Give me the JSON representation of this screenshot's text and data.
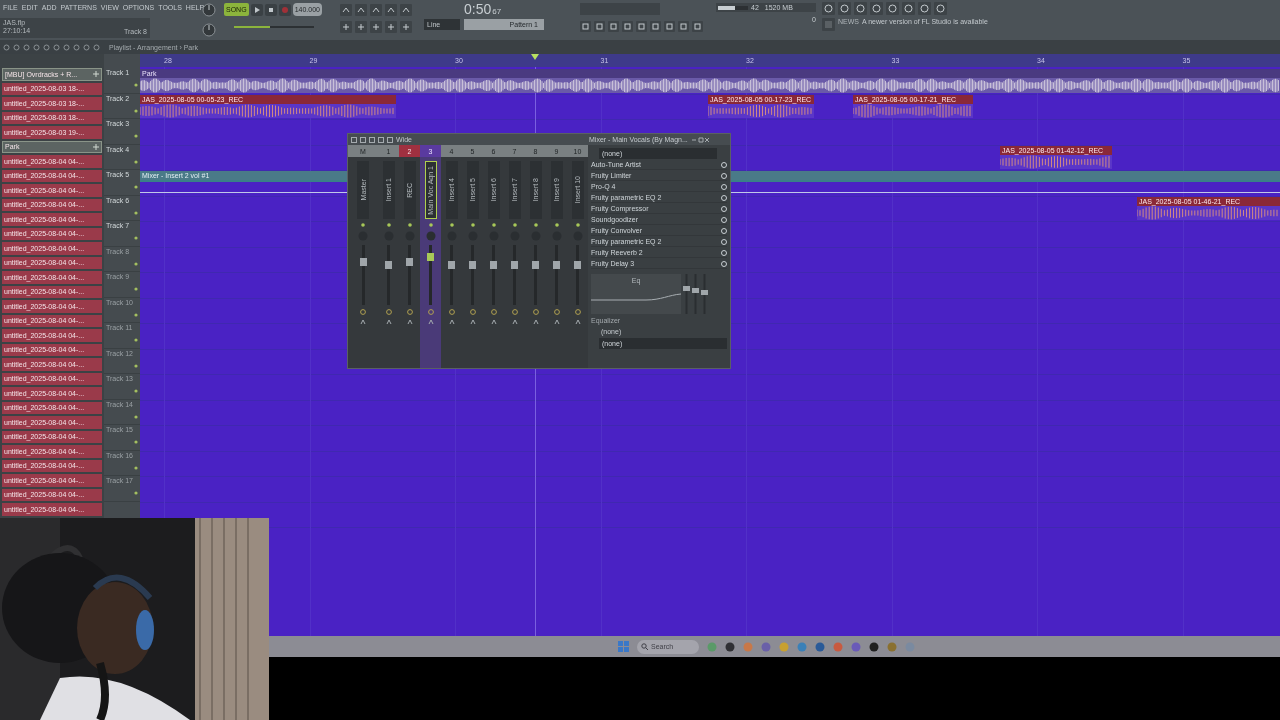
{
  "menu": [
    "FILE",
    "EDIT",
    "ADD",
    "PATTERNS",
    "VIEW",
    "OPTIONS",
    "TOOLS",
    "HELP"
  ],
  "project": {
    "file": "JAS.flp",
    "time": "27:10:14",
    "track": "Track 8"
  },
  "transport": {
    "mode": "SONG",
    "tempo": "140.000",
    "song_time": "0:50",
    "song_time_small": "67",
    "playing": false,
    "recording": false
  },
  "monitor": {
    "voices": "42",
    "memory": "1520 MB",
    "cpu": "0",
    "level": 0.55
  },
  "snap": "Line",
  "pattern": "Pattern 1",
  "news": {
    "label": "NEWS",
    "text": "A newer version of FL Studio is available"
  },
  "master_pitch": {
    "level": 0.45
  },
  "playlist": {
    "title": "Playlist - Arrangement › Park",
    "ruler": [
      "28",
      "29",
      "30",
      "31",
      "32",
      "33",
      "34",
      "35"
    ],
    "picker": [
      {
        "kind": "pattern",
        "label": "[MBU] Ovrdracks + R..."
      },
      {
        "kind": "audio",
        "label": "untitled_2025-08-03 18-..."
      },
      {
        "kind": "audio",
        "label": "untitled_2025-08-03 18-..."
      },
      {
        "kind": "audio",
        "label": "untitled_2025-08-03 18-..."
      },
      {
        "kind": "audio",
        "label": "untitled_2025-08-03 19-..."
      },
      {
        "kind": "pattern",
        "label": "Park"
      },
      {
        "kind": "audio",
        "label": "untitled_2025-08-04 04-..."
      },
      {
        "kind": "audio",
        "label": "untitled_2025-08-04 04-..."
      },
      {
        "kind": "audio",
        "label": "untitled_2025-08-04 04-..."
      },
      {
        "kind": "audio",
        "label": "untitled_2025-08-04 04-..."
      },
      {
        "kind": "audio",
        "label": "untitled_2025-08-04 04-..."
      },
      {
        "kind": "audio",
        "label": "untitled_2025-08-04 04-..."
      },
      {
        "kind": "audio",
        "label": "untitled_2025-08-04 04-..."
      },
      {
        "kind": "audio",
        "label": "untitled_2025-08-04 04-..."
      },
      {
        "kind": "audio",
        "label": "untitled_2025-08-04 04-..."
      },
      {
        "kind": "audio",
        "label": "untitled_2025-08-04 04-..."
      },
      {
        "kind": "audio",
        "label": "untitled_2025-08-04 04-..."
      },
      {
        "kind": "audio",
        "label": "untitled_2025-08-04 04-..."
      },
      {
        "kind": "audio",
        "label": "untitled_2025-08-04 04-..."
      },
      {
        "kind": "audio",
        "label": "untitled_2025-08-04 04-..."
      },
      {
        "kind": "audio",
        "label": "untitled_2025-08-04 04-..."
      },
      {
        "kind": "audio",
        "label": "untitled_2025-08-04 04-..."
      },
      {
        "kind": "audio",
        "label": "untitled_2025-08-04 04-..."
      },
      {
        "kind": "audio",
        "label": "untitled_2025-08-04 04-..."
      },
      {
        "kind": "audio",
        "label": "untitled_2025-08-04 04-..."
      },
      {
        "kind": "audio",
        "label": "untitled_2025-08-04 04-..."
      },
      {
        "kind": "audio",
        "label": "untitled_2025-08-04 04-..."
      },
      {
        "kind": "audio",
        "label": "untitled_2025-08-04 04-..."
      },
      {
        "kind": "audio",
        "label": "untitled_2025-08-04 04-..."
      },
      {
        "kind": "audio",
        "label": "untitled_2025-08-04 04-..."
      },
      {
        "kind": "audio",
        "label": "untitled_2025-08-04 04-..."
      }
    ],
    "tracks": [
      {
        "name": "Track 1",
        "used": true
      },
      {
        "name": "Track 2",
        "used": true
      },
      {
        "name": "Track 3",
        "used": true
      },
      {
        "name": "Track 4",
        "used": true
      },
      {
        "name": "Track 5",
        "used": true
      },
      {
        "name": "Track 6",
        "used": true
      },
      {
        "name": "Track 7",
        "used": true
      },
      {
        "name": "Track 8",
        "used": false
      },
      {
        "name": "Track 9",
        "used": false
      },
      {
        "name": "Track 10",
        "used": false
      },
      {
        "name": "Track 11",
        "used": false
      },
      {
        "name": "Track 12",
        "used": false
      },
      {
        "name": "Track 13",
        "used": false
      },
      {
        "name": "Track 14",
        "used": false
      },
      {
        "name": "Track 15",
        "used": false
      },
      {
        "name": "Track 16",
        "used": false
      },
      {
        "name": "Track 17",
        "used": false
      }
    ],
    "clips": [
      {
        "kind": "audio",
        "label": "Park"
      },
      {
        "kind": "audio",
        "label": "JAS_2025-08-05 00-05-23_REC"
      },
      {
        "kind": "audio",
        "label": "JAS_2025-08-05 00-17-23_REC"
      },
      {
        "kind": "audio",
        "label": "JAS_2025-08-05 00-17-21_REC"
      },
      {
        "kind": "audio",
        "label": "JAS_2025-08-05 01-42-12_REC"
      },
      {
        "kind": "automation",
        "label": "Mixer - Insert 2 vol #1"
      },
      {
        "kind": "audio",
        "label": "JAS_2025-08-05 01-46-21_REC"
      }
    ]
  },
  "mixer": {
    "preset": "Wide",
    "title": "Mixer - Main Vocals (By Magn...",
    "strips": [
      {
        "number": "M",
        "name": "Master",
        "level": 0.75,
        "selected": false
      },
      {
        "number": "1",
        "name": "Insert 1",
        "level": 0.7,
        "selected": false
      },
      {
        "number": "2",
        "name": "REC",
        "level": 0.75,
        "selected": false
      },
      {
        "number": "3",
        "name": "Main Voc Aqn 1",
        "level": 0.85,
        "selected": true
      },
      {
        "number": "4",
        "name": "Insert 4",
        "level": 0.7,
        "selected": false
      },
      {
        "number": "5",
        "name": "Insert 5",
        "level": 0.7,
        "selected": false
      },
      {
        "number": "6",
        "name": "Insert 6",
        "level": 0.7,
        "selected": false
      },
      {
        "number": "7",
        "name": "Insert 7",
        "level": 0.7,
        "selected": false
      },
      {
        "number": "8",
        "name": "Insert 8",
        "level": 0.7,
        "selected": false
      },
      {
        "number": "9",
        "name": "Insert 9",
        "level": 0.7,
        "selected": false
      },
      {
        "number": "10",
        "name": "Insert 10",
        "level": 0.7,
        "selected": false
      }
    ],
    "input": "(none)",
    "slots": [
      {
        "name": "Auto-Tune Artist",
        "on": true
      },
      {
        "name": "Fruity Limiter",
        "on": true
      },
      {
        "name": "Pro-Q 4",
        "on": true
      },
      {
        "name": "Fruity parametric EQ 2",
        "on": true
      },
      {
        "name": "Fruity Compressor",
        "on": true
      },
      {
        "name": "Soundgoodizer",
        "on": true
      },
      {
        "name": "Fruity Convolver",
        "on": true
      },
      {
        "name": "Fruity parametric EQ 2",
        "on": true
      },
      {
        "name": "Fruity Reeverb 2",
        "on": true
      },
      {
        "name": "Fruity Delay 3",
        "on": true
      }
    ],
    "eq_label": "Eq",
    "equalizer": "Equalizer",
    "send": "(none)",
    "output": "(none)"
  },
  "taskbar": {
    "search": "Search"
  }
}
